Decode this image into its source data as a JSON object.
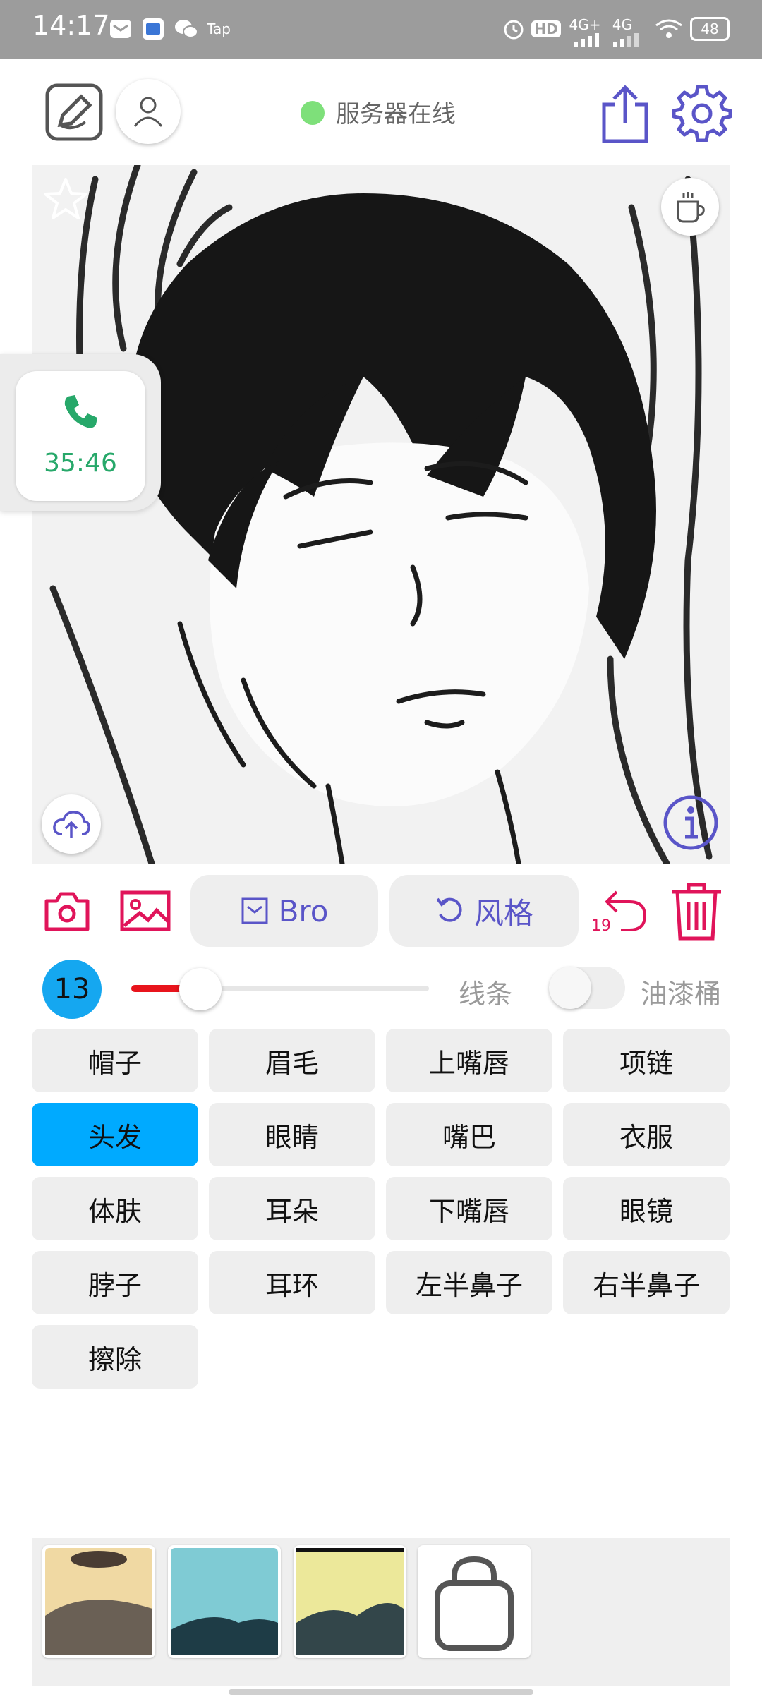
{
  "status_bar": {
    "time": "14:17",
    "right_badge_hd": "HD",
    "net1": "4G+",
    "net2": "4G",
    "battery": "48",
    "tap_label": "Tap"
  },
  "header": {
    "server_status": "服务器在线",
    "status_color": "#7ee07a"
  },
  "call_widget": {
    "time": "35:46",
    "color": "#27a86a"
  },
  "toolbar": {
    "bro_label": "Bro",
    "style_label": "风格",
    "undo_count": "19",
    "accent_color": "#e0145a",
    "purple_color": "#5a55c8"
  },
  "brush": {
    "size": "13",
    "line_label": "线条",
    "bucket_label": "油漆桶",
    "slider_value_fraction": 0.16
  },
  "parts": [
    "帽子",
    "眉毛",
    "上嘴唇",
    "项链",
    "头发",
    "眼睛",
    "嘴巴",
    "衣服",
    "体肤",
    "耳朵",
    "下嘴唇",
    "眼镜",
    "脖子",
    "耳环",
    "左半鼻子",
    "右半鼻子",
    "擦除"
  ],
  "selected_part": "头发",
  "selected_color": "#00aaff"
}
